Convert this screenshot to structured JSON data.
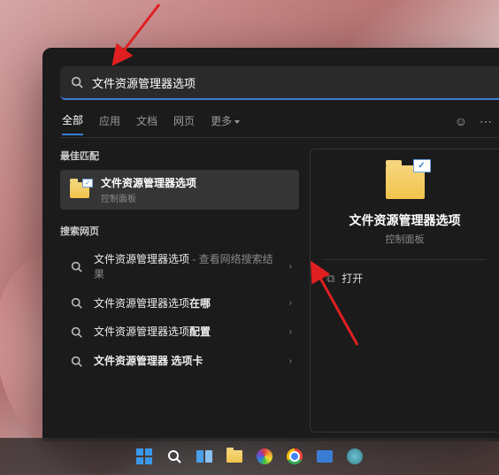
{
  "search": {
    "value": "文件资源管理器选项"
  },
  "tabs": {
    "all": "全部",
    "apps": "应用",
    "docs": "文档",
    "web": "网页",
    "more": "更多"
  },
  "sections": {
    "best_match": "最佳匹配",
    "search_web": "搜索网页"
  },
  "best_match": {
    "title": "文件资源管理器选项",
    "subtitle": "控制面板"
  },
  "web_results": [
    {
      "main": "文件资源管理器选项",
      "suffix": " - 查看网络搜索结果"
    },
    {
      "main": "文件资源管理器选项",
      "suffix": "在哪"
    },
    {
      "main": "文件资源管理器选项",
      "suffix": "配置"
    },
    {
      "main": "文件资源管理器 选项卡",
      "suffix": ""
    }
  ],
  "preview": {
    "title": "文件资源管理器选项",
    "subtitle": "控制面板",
    "open": "打开"
  }
}
